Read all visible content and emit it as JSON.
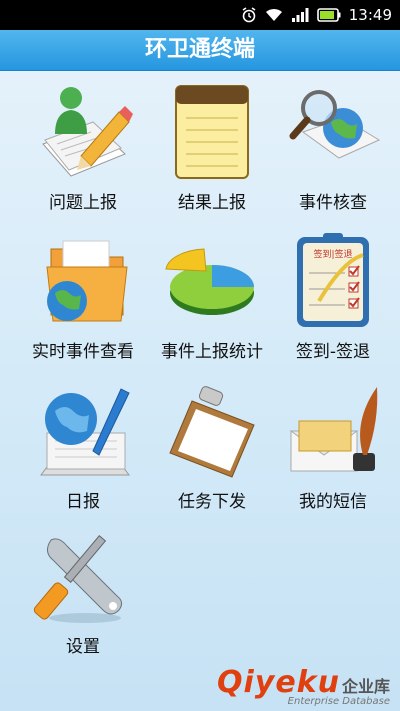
{
  "status": {
    "time": "13:49"
  },
  "app": {
    "title": "环卫通终端"
  },
  "menu": [
    {
      "label": "问题上报",
      "icon": "report-pencil-icon"
    },
    {
      "label": "结果上报",
      "icon": "notepad-icon"
    },
    {
      "label": "事件核查",
      "icon": "globe-magnifier-icon"
    },
    {
      "label": "实时事件查看",
      "icon": "folder-globe-icon"
    },
    {
      "label": "事件上报统计",
      "icon": "pie-chart-icon"
    },
    {
      "label": "签到-签退",
      "icon": "checklist-clipboard-icon"
    },
    {
      "label": "日报",
      "icon": "globe-book-icon"
    },
    {
      "label": "任务下发",
      "icon": "clipboard-icon"
    },
    {
      "label": "我的短信",
      "icon": "envelope-quill-icon"
    },
    {
      "label": "设置",
      "icon": "tools-icon"
    }
  ],
  "clipboard_header": "签到|签退",
  "watermark": {
    "brand": "Qiyeku",
    "cn": "企业库",
    "sub": "Enterprise Database"
  }
}
